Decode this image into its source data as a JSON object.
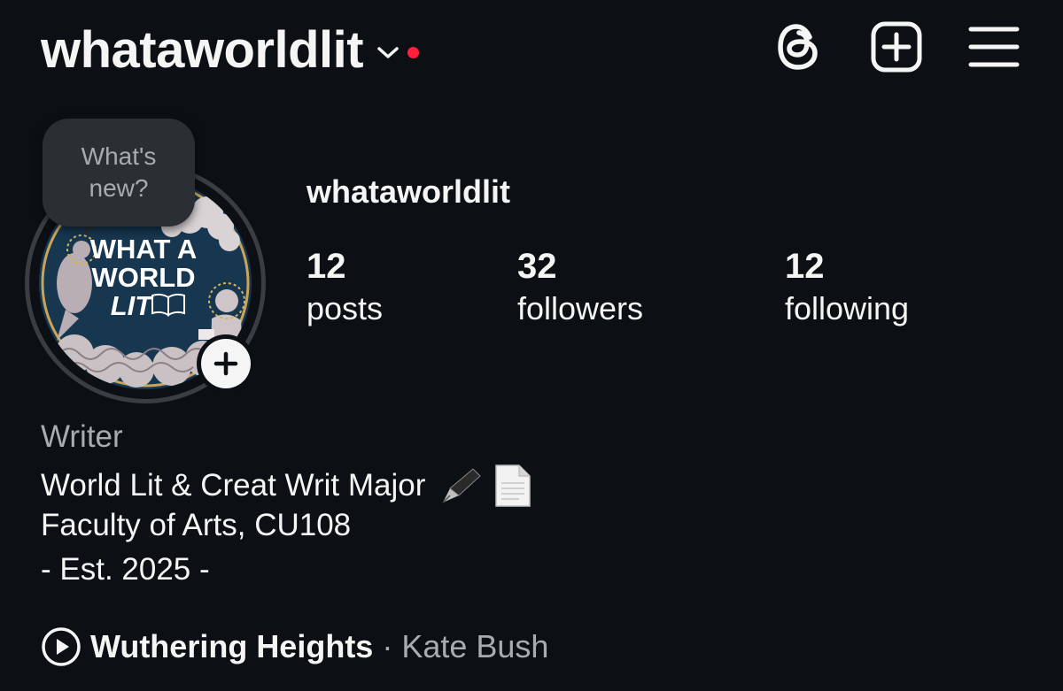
{
  "header": {
    "username": "whataworldlit",
    "has_notification_dot": true,
    "icons": [
      "threads-icon",
      "new-post-icon",
      "menu-icon"
    ]
  },
  "avatar": {
    "logo_text": [
      "WHAT A",
      "WORLD",
      "LIT"
    ],
    "bubble_text": "What's new?"
  },
  "profile": {
    "name": "whataworldlit",
    "stats": [
      {
        "value": "12",
        "label": "posts"
      },
      {
        "value": "32",
        "label": "followers"
      },
      {
        "value": "12",
        "label": "following"
      }
    ]
  },
  "bio": {
    "category": "Writer",
    "line1": "World Lit & Creat Writ Major",
    "line2": "Faculty of Arts, CU108",
    "line3": "- Est. 2025 -",
    "emojis": [
      "fountain-pen-icon",
      "page-facing-up-icon"
    ]
  },
  "music": {
    "song": "Wuthering Heights",
    "separator": "·",
    "artist": "Kate Bush"
  },
  "colors": {
    "background": "#0c1014",
    "text": "#f5f5f5",
    "muted": "#a8abb0",
    "notification": "#ff1f3d",
    "avatar_bg": "#17364f"
  }
}
